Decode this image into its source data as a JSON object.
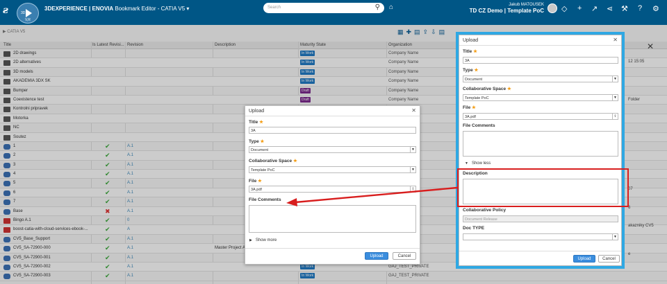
{
  "topbar": {
    "brand": "3DEXPERIENCE | ENOVIA",
    "app": "Bookmark Editor - CATIA V5",
    "search_placeholder": "Search",
    "user_name": "Jakub MATOUSEK",
    "context": "TD CZ Demo | Template PoC",
    "compass_version": "V,R",
    "compass_left": "3D",
    "colors": {
      "bar": "#005686",
      "accent": "#2fa8e3",
      "highlight": "#d81e1e"
    },
    "icons": [
      "tag-icon",
      "share-icon",
      "add-icon",
      "forward-icon",
      "network-icon",
      "tools-icon",
      "help-icon",
      "settings-icon"
    ]
  },
  "page": {
    "breadcrumb": "CATIA V5",
    "columns": [
      "Title",
      "Is Latest Revisi...",
      "Revision",
      "Description",
      "Maturity State",
      "Organization"
    ],
    "rows": [
      {
        "title": "2D drawings",
        "latest": "",
        "revision": "",
        "description": "",
        "state": "In Work",
        "org": "Company Name",
        "icon": "folder"
      },
      {
        "title": "2D alternatives",
        "latest": "",
        "revision": "",
        "description": "",
        "state": "In Work",
        "org": "Company Name",
        "icon": "folder"
      },
      {
        "title": "3D models",
        "latest": "",
        "revision": "",
        "description": "",
        "state": "In Work",
        "org": "Company Name",
        "icon": "folder"
      },
      {
        "title": "AKADEMIA 3DX SK",
        "latest": "",
        "revision": "",
        "description": "",
        "state": "In Work",
        "org": "Company Name",
        "icon": "folder"
      },
      {
        "title": "Bumper",
        "latest": "",
        "revision": "",
        "description": "",
        "state": "Draft",
        "org": "Company Name",
        "icon": "folder"
      },
      {
        "title": "Coexistence test",
        "latest": "",
        "revision": "",
        "description": "",
        "state": "Draft",
        "org": "Company Name",
        "icon": "folder"
      },
      {
        "title": "Kontrolni pripravek",
        "latest": "",
        "revision": "",
        "description": "",
        "state": "",
        "org": "",
        "icon": "folder"
      },
      {
        "title": "Motorka",
        "latest": "",
        "revision": "",
        "description": "",
        "state": "",
        "org": "",
        "icon": "folder"
      },
      {
        "title": "NC",
        "latest": "",
        "revision": "",
        "description": "",
        "state": "",
        "org": "",
        "icon": "folder"
      },
      {
        "title": "Soutez",
        "latest": "",
        "revision": "",
        "description": "",
        "state": "",
        "org": "",
        "icon": "folder"
      },
      {
        "title": "1",
        "latest": "check",
        "revision": "A.1",
        "description": "",
        "state": "",
        "org": "",
        "icon": "part"
      },
      {
        "title": "2",
        "latest": "check",
        "revision": "A.1",
        "description": "",
        "state": "",
        "org": "",
        "icon": "part"
      },
      {
        "title": "3",
        "latest": "check",
        "revision": "A.1",
        "description": "",
        "state": "",
        "org": "",
        "icon": "part"
      },
      {
        "title": "4",
        "latest": "check",
        "revision": "A.1",
        "description": "",
        "state": "",
        "org": "",
        "icon": "part"
      },
      {
        "title": "5",
        "latest": "check",
        "revision": "A.1",
        "description": "",
        "state": "",
        "org": "",
        "icon": "part"
      },
      {
        "title": "6",
        "latest": "check",
        "revision": "A.1",
        "description": "",
        "state": "",
        "org": "",
        "icon": "part"
      },
      {
        "title": "7",
        "latest": "check",
        "revision": "A.1",
        "description": "",
        "state": "",
        "org": "",
        "icon": "part"
      },
      {
        "title": "Base",
        "latest": "cross",
        "revision": "A.1",
        "description": "",
        "state": "",
        "org": "",
        "icon": "part"
      },
      {
        "title": "Bingo A.1",
        "latest": "check",
        "revision": "0",
        "description": "",
        "state": "",
        "org": "",
        "icon": "doc"
      },
      {
        "title": "boost-catia-with-cloud-services-ebook-...",
        "latest": "check",
        "revision": "A",
        "description": "",
        "state": "",
        "org": "",
        "icon": "doc"
      },
      {
        "title": "CV5_Base_Support",
        "latest": "check",
        "revision": "A.1",
        "description": "",
        "state": "",
        "org": "",
        "icon": "part"
      },
      {
        "title": "CV5_SA-72900-000",
        "latest": "check",
        "revision": "A.1",
        "description": "Master Project A",
        "state": "",
        "org": "",
        "icon": "part"
      },
      {
        "title": "CV5_SA-72900-001",
        "latest": "check",
        "revision": "A.1",
        "description": "",
        "state": "",
        "org": "",
        "icon": "part"
      },
      {
        "title": "CV5_SA-72900-002",
        "latest": "check",
        "revision": "A.1",
        "description": "",
        "state": "In Work",
        "org": "GAJ_TEST_PRIVATE",
        "icon": "part"
      },
      {
        "title": "CV5_SA-72900-003",
        "latest": "check",
        "revision": "A.1",
        "description": "",
        "state": "In Work",
        "org": "GAJ_TEST_PRIVATE",
        "icon": "part"
      }
    ],
    "side_texts": [
      "12 15:05",
      "Folder",
      "07",
      "6",
      "akazniky CV5",
      "e"
    ]
  },
  "dialog_small": {
    "title": "Upload",
    "title_label": "Title",
    "title_value": "3A",
    "type_label": "Type",
    "type_value": "Document",
    "space_label": "Collaborative Space",
    "space_value": "Template PoC",
    "file_label": "File",
    "file_value": "3A.pdf",
    "comments_label": "File Comments",
    "toggle_label": "Show more",
    "upload_label": "Upload",
    "cancel_label": "Cancel"
  },
  "dialog_large": {
    "title": "Upload",
    "title_label": "Title",
    "title_value": "3A",
    "type_label": "Type",
    "type_value": "Document",
    "space_label": "Collaborative Space",
    "space_value": "Template PoC",
    "file_label": "File",
    "file_value": "3A.pdf",
    "comments_label": "File Comments",
    "toggle_label": "Show less",
    "description_label": "Description",
    "policy_label": "Collaborative Policy",
    "policy_value": "Document Release",
    "doctype_label": "Doc TYPE",
    "doctype_value": "",
    "upload_label": "Upload",
    "cancel_label": "Cancel"
  }
}
